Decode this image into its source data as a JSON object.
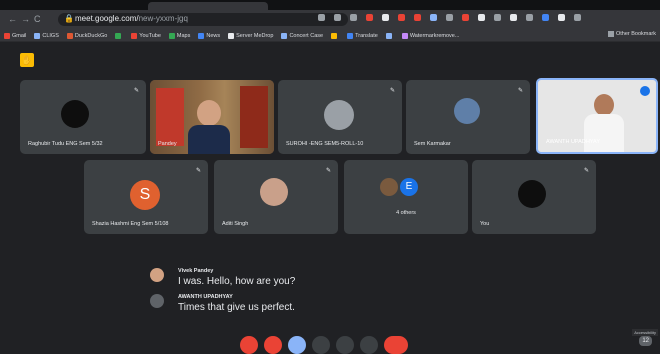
{
  "browser": {
    "url_domain": "meet.google.com/",
    "url_path": "new-yxxm-jgq",
    "nav": {
      "back": "←",
      "forward": "→",
      "reload": "C"
    },
    "toolbar_icon_colors": [
      "#9aa0a6",
      "#9aa0a6",
      "#9aa0a6",
      "#ea4335",
      "#e8eaed",
      "#ea4335",
      "#e94235",
      "#8ab4f8",
      "#9aa0a6",
      "#ea4335",
      "#e8eaed",
      "#9aa0a6",
      "#e8eaed",
      "#9aa0a6",
      "#4285f4",
      "#e8eaed",
      "#9aa0a6"
    ],
    "bookmarks": [
      {
        "label": "Gmail",
        "color": "#ea4335"
      },
      {
        "label": "CLIGS",
        "color": "#8ab4f8"
      },
      {
        "label": "DuckDuckGo",
        "color": "#de5833"
      },
      {
        "label": "",
        "color": "#34a853"
      },
      {
        "label": "YouTube",
        "color": "#ea4335"
      },
      {
        "label": "Maps",
        "color": "#34a853"
      },
      {
        "label": "News",
        "color": "#4285f4"
      },
      {
        "label": "Server MeDrop",
        "color": "#e8eaed"
      },
      {
        "label": "Concert Case",
        "color": "#8ab4f8"
      },
      {
        "label": "",
        "color": "#fbbc04"
      },
      {
        "label": "Translate",
        "color": "#4285f4"
      },
      {
        "label": "",
        "color": "#8ab4f8"
      },
      {
        "label": "Watermarkremove...",
        "color": "#c58af9"
      }
    ],
    "other_bookmarks": "Other Bookmark"
  },
  "meet": {
    "badge_icon": "hand-icon",
    "row1": [
      {
        "name": "Raghubir Tudu ENG Sem 5/32",
        "avatar": "dark"
      },
      {
        "name": "Pandey",
        "avatar": "video"
      },
      {
        "name": "SUROHI -ENG SEM5-ROLL-10",
        "avatar": "photo-grey"
      },
      {
        "name": "Sem Karmakar",
        "avatar": "photo-guitar"
      },
      {
        "name": "AWANTH UPADHYAY",
        "avatar": "video2"
      }
    ],
    "row2": [
      {
        "name": "Shazia Hashmi Eng Sem 5/108",
        "avatar": "S"
      },
      {
        "name": "Aditi Singh",
        "avatar": "photo-girl"
      },
      {
        "name": "4 others",
        "avatar": "E"
      },
      {
        "name": "You",
        "avatar": "dark"
      }
    ],
    "captions": [
      {
        "speaker": "Vivek Pandey",
        "text": "I was. Hello, how are you?"
      },
      {
        "speaker": "AWANTH UPADHYAY",
        "text": "Times that give us perfect."
      }
    ],
    "participant_count": "12",
    "toast": "Accessibility"
  }
}
